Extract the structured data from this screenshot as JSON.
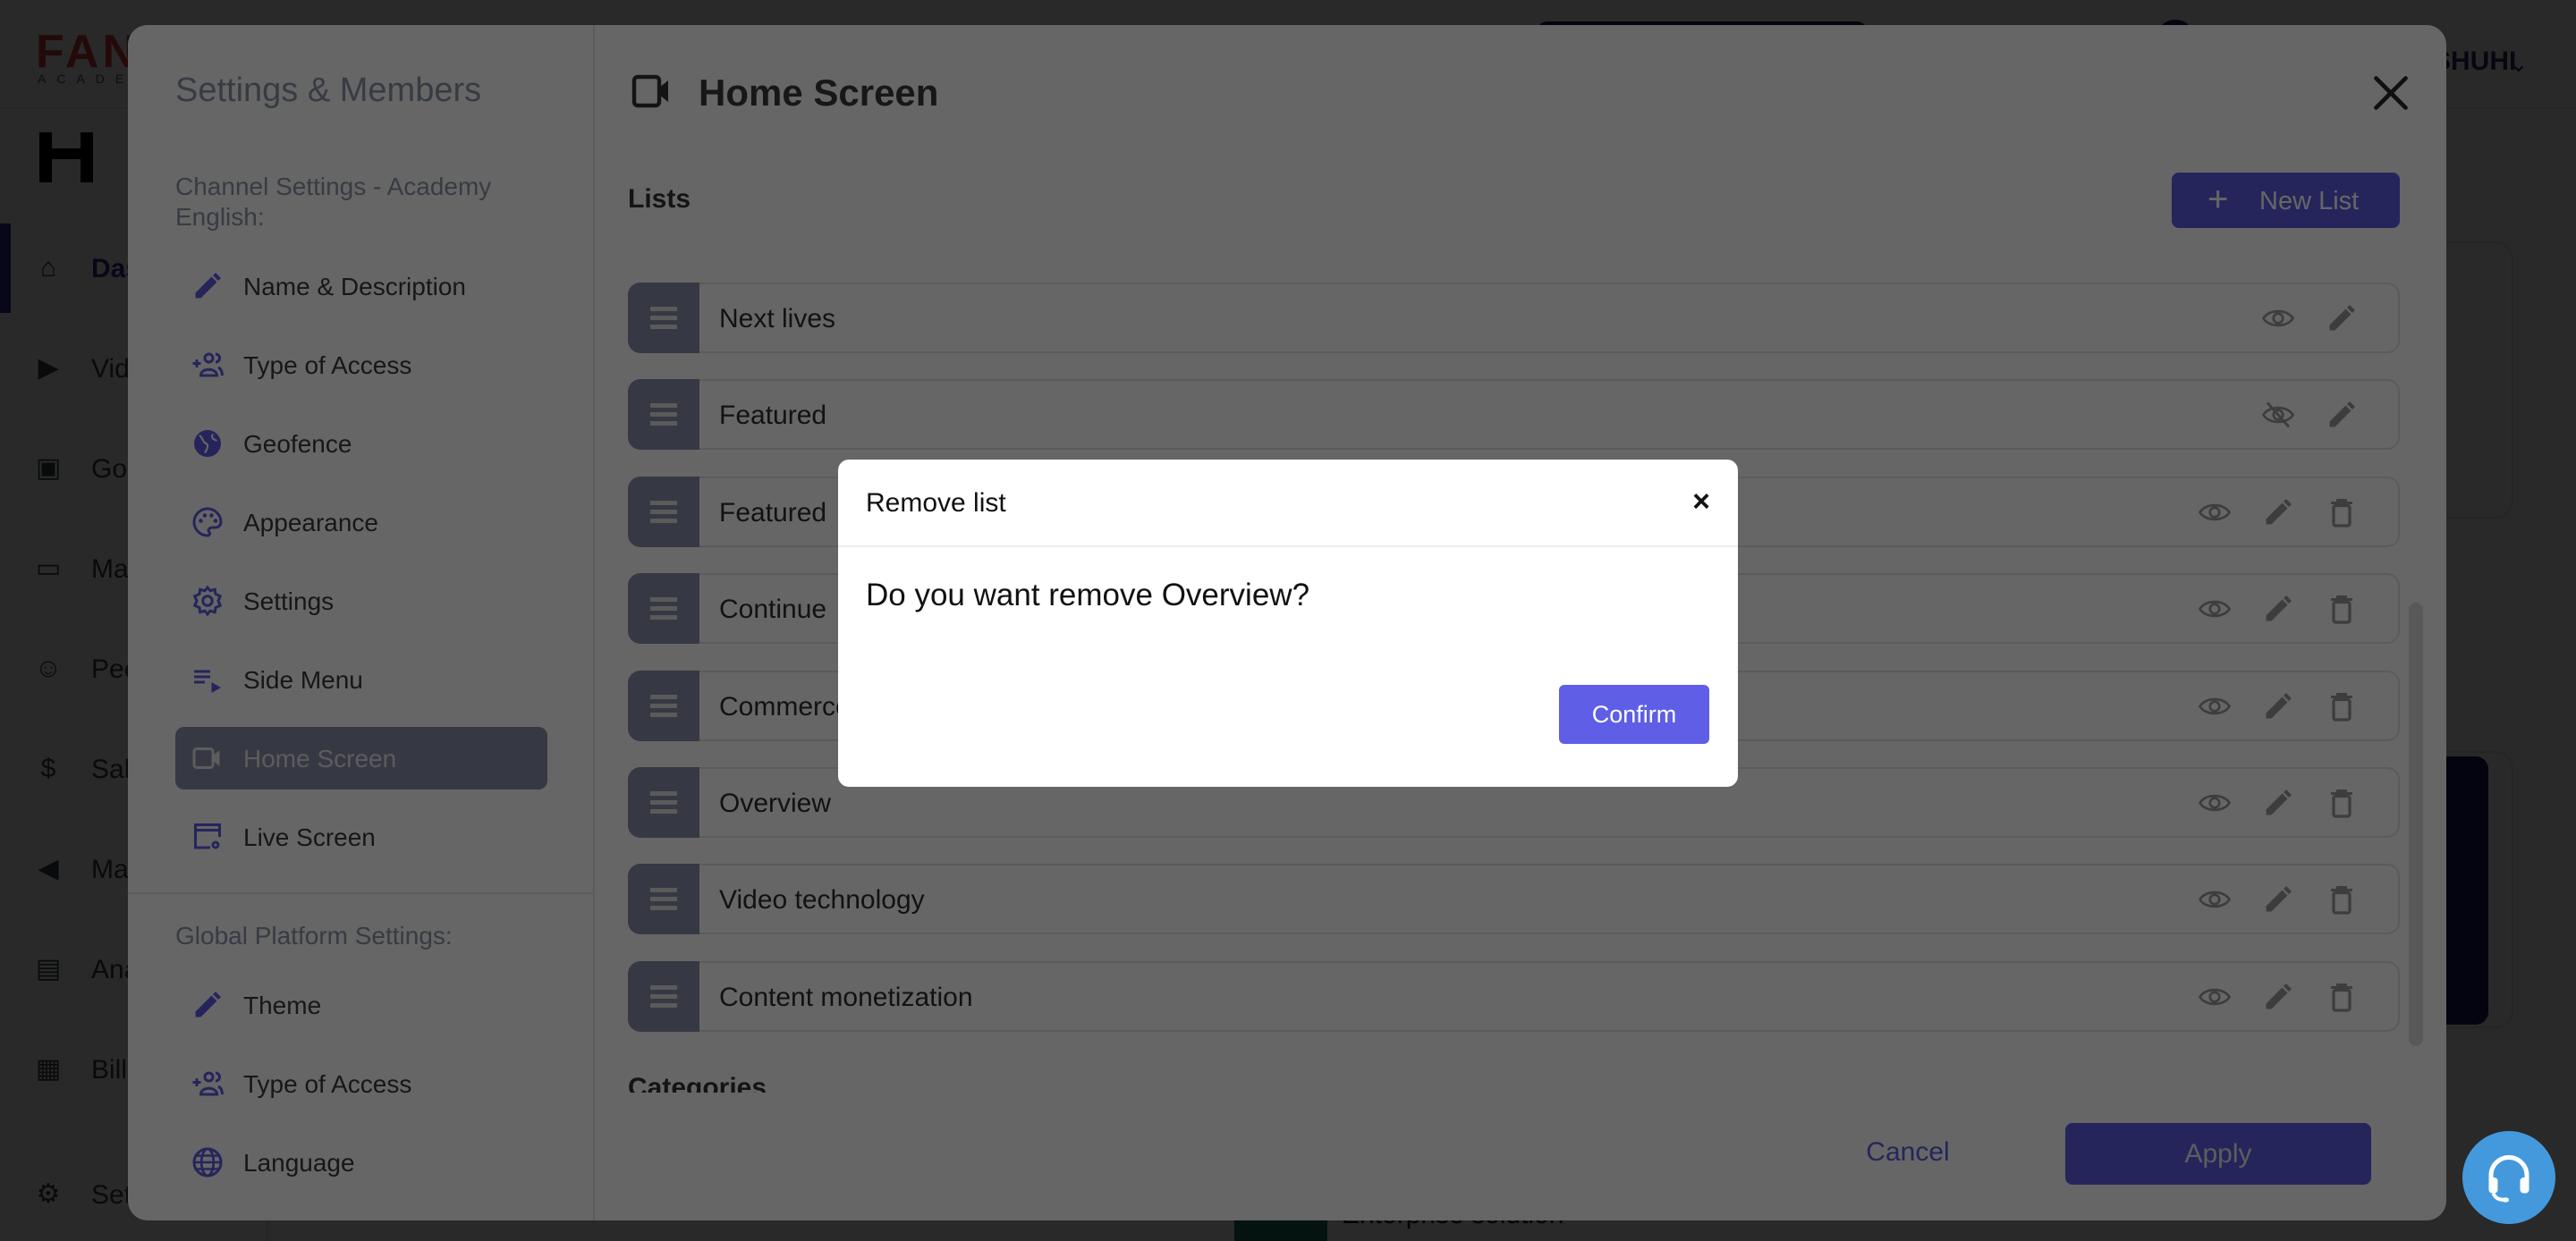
{
  "background_app": {
    "logo": "FANHERO",
    "logo_sub": "ACADEMY",
    "user_name": "SHUHI",
    "nav": [
      {
        "label": "Dashboard",
        "icon": "home-icon",
        "active": true
      },
      {
        "label": "Videos",
        "icon": "play-circle-icon"
      },
      {
        "label": "Go Live",
        "icon": "tv-play-icon"
      },
      {
        "label": "Manage",
        "icon": "folder-gear-icon"
      },
      {
        "label": "People",
        "icon": "users-icon"
      },
      {
        "label": "Sales",
        "icon": "dollar-icon"
      },
      {
        "label": "Marketing",
        "icon": "megaphone-icon"
      },
      {
        "label": "Analytics",
        "icon": "chart-icon"
      },
      {
        "label": "Billing",
        "icon": "invoice-icon"
      },
      {
        "label": "Settings",
        "icon": "gear-icon"
      }
    ],
    "card_text": "Enterprise solution"
  },
  "settings_modal": {
    "title": "Settings & Members",
    "channel_section": "Channel Settings - Academy English:",
    "channel_items": [
      {
        "label": "Name & Description",
        "icon": "pencil-icon"
      },
      {
        "label": "Type of Access",
        "icon": "add-group-icon"
      },
      {
        "label": "Geofence",
        "icon": "globe-filled-icon"
      },
      {
        "label": "Appearance",
        "icon": "palette-icon"
      },
      {
        "label": "Settings",
        "icon": "gear-icon"
      },
      {
        "label": "Side Menu",
        "icon": "playlist-icon"
      },
      {
        "label": "Home Screen",
        "icon": "video-camera-icon",
        "active": true
      },
      {
        "label": "Live Screen",
        "icon": "window-gear-icon"
      }
    ],
    "global_section": "Global Platform Settings:",
    "global_items": [
      {
        "label": "Theme",
        "icon": "pencil-icon"
      },
      {
        "label": "Type of Access",
        "icon": "add-group-icon"
      },
      {
        "label": "Language",
        "icon": "globe-icon"
      }
    ],
    "content": {
      "title": "Home Screen",
      "lists_label": "Lists",
      "new_list_label": "New List",
      "lists": [
        {
          "name": "Next lives",
          "visible": true,
          "deletable": false
        },
        {
          "name": "Featured",
          "visible": false,
          "deletable": false
        },
        {
          "name": "Featured",
          "visible": true,
          "deletable": true
        },
        {
          "name": "Continue",
          "visible": true,
          "deletable": true
        },
        {
          "name": "Commerce",
          "visible": true,
          "deletable": true
        },
        {
          "name": "Overview",
          "visible": true,
          "deletable": true
        },
        {
          "name": "Video technology",
          "visible": true,
          "deletable": true
        },
        {
          "name": "Content monetization",
          "visible": true,
          "deletable": true
        }
      ],
      "categories_label": "Categories"
    },
    "cancel_label": "Cancel",
    "apply_label": "Apply"
  },
  "dialog": {
    "title": "Remove list",
    "close_glyph": "×",
    "message": "Do you want remove Overview?",
    "confirm_label": "Confirm"
  },
  "colors": {
    "brand": "#5e5ee6",
    "support": "#4499dd"
  }
}
